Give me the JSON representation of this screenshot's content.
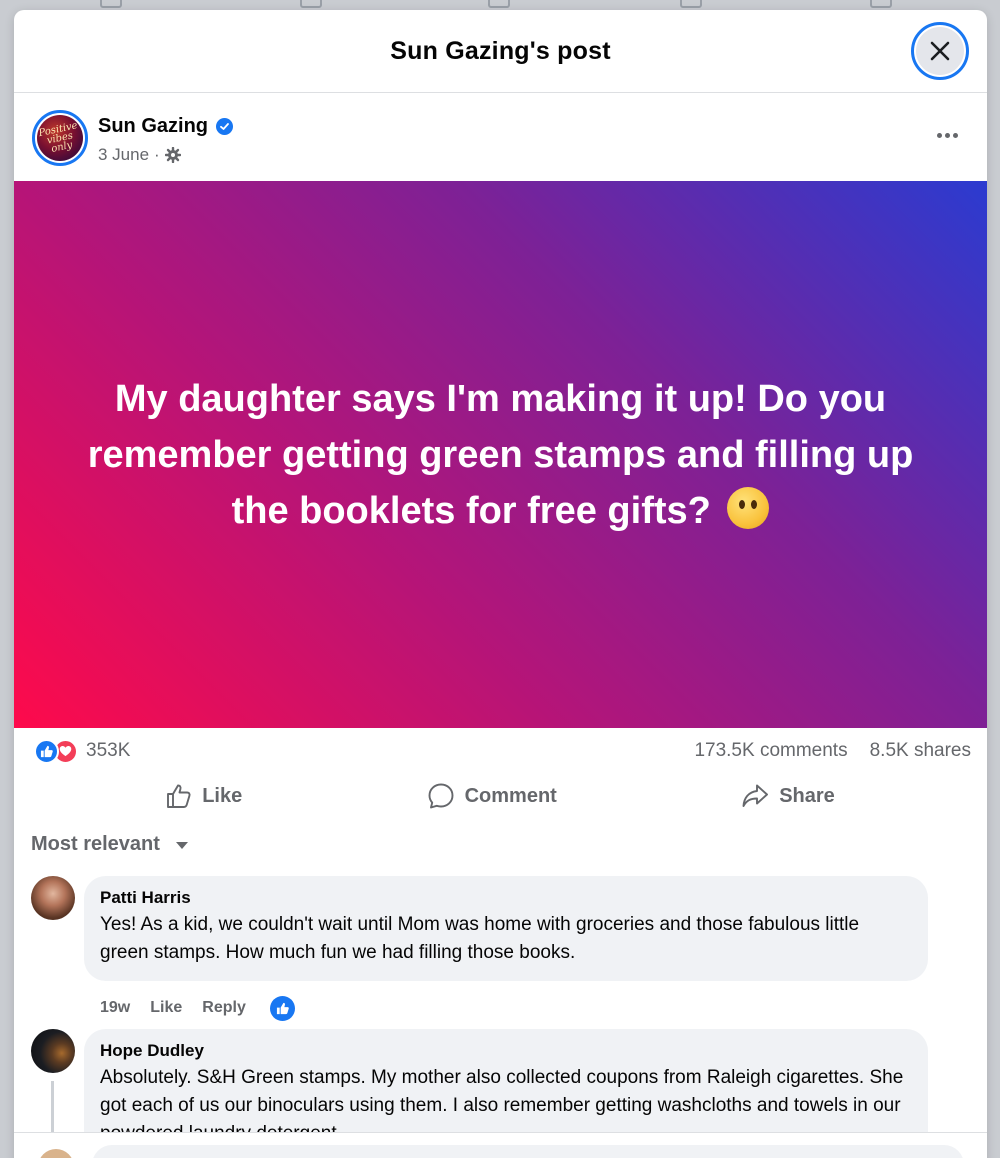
{
  "dialog": {
    "title": "Sun Gazing's post",
    "close_icon": "close-icon"
  },
  "post": {
    "author": "Sun Gazing",
    "avatar_text": "Positive vibes only",
    "date": "3 June",
    "separator": "·",
    "privacy_icon": "gear-icon",
    "text": "My daughter says I'm making it up! Do you remember getting green stamps and filling up the booklets for free gifts?",
    "emoji": "thinking-face",
    "gradient_colors": [
      "#fe0a4b",
      "#b2157a",
      "#7d2196",
      "#2b3bd0"
    ]
  },
  "reactions": {
    "count": "353K",
    "types": [
      "like",
      "love"
    ],
    "comments": "173.5K comments",
    "shares": "8.5K shares"
  },
  "actions": {
    "like": "Like",
    "comment": "Comment",
    "share": "Share"
  },
  "sort": {
    "label": "Most relevant"
  },
  "comments": [
    {
      "name": "Patti Harris",
      "text": "Yes! As a kid, we couldn't wait until Mom was home with groceries and those fabulous little green stamps. How much fun we had filling those books.",
      "age": "19w",
      "like_label": "Like",
      "reply_label": "Reply"
    },
    {
      "name": "Hope Dudley",
      "text": "Absolutely. S&H Green stamps. My mother also collected coupons from Raleigh cigarettes. She got each of us our binoculars using them. I also remember getting washcloths and towels in our powdered laundry detergent."
    }
  ],
  "colors": {
    "accent": "#1877f2",
    "love": "#f33e58",
    "secondary_text": "#65676b",
    "bubble": "#f0f2f5"
  }
}
